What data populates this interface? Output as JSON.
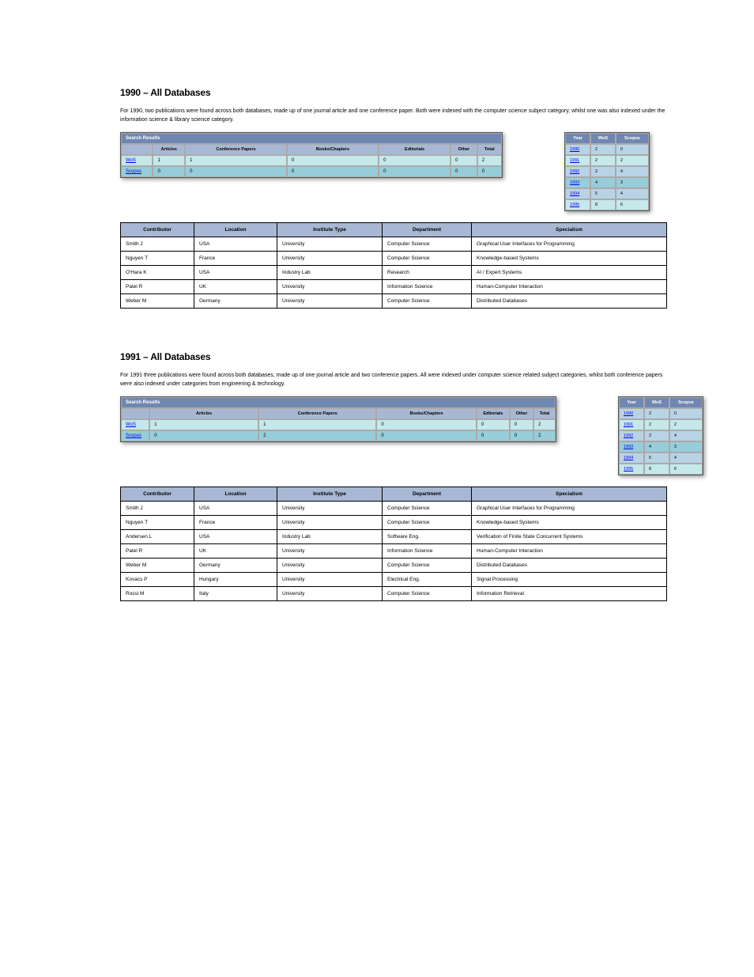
{
  "section1": {
    "title": "1990 – All Databases",
    "blurb": "For 1990, two publications were found across both databases, made up of one journal article and one conference paper. Both were indexed with the computer science subject category, whilst one was also indexed under the information science & library science category.",
    "results": {
      "band": "Search Results",
      "columns": [
        "db",
        "Articles",
        "Conference Papers",
        "Books/Chapters",
        "Editorials",
        "Other",
        "Total"
      ],
      "rows": [
        {
          "db": "WoS",
          "articles": "1",
          "conf": "1",
          "books": "0",
          "editorials": "0",
          "other": "0",
          "total": "2"
        },
        {
          "db": "Scopus",
          "articles": "0",
          "conf": "0",
          "books": "0",
          "editorials": "0",
          "other": "0",
          "total": "0"
        }
      ]
    },
    "side": {
      "headers": [
        "Year",
        "WoS",
        "Scopus"
      ],
      "rows": [
        {
          "y": "1990",
          "a": "2",
          "b": "0",
          "cls": "alt"
        },
        {
          "y": "1991",
          "a": "2",
          "b": "2",
          "cls": "light"
        },
        {
          "y": "1992",
          "a": "2",
          "b": "4",
          "cls": "alt"
        },
        {
          "y": "1993",
          "a": "4",
          "b": "3",
          "cls": "mid"
        },
        {
          "y": "1994",
          "a": "5",
          "b": "4",
          "cls": "alt"
        },
        {
          "y": "1995",
          "a": "8",
          "b": "6",
          "cls": "light"
        }
      ]
    },
    "contrib": {
      "headers": [
        "Contributor",
        "Location",
        "Institute Type",
        "Department",
        "Specialism"
      ],
      "rows": [
        {
          "c": "Smith J",
          "l": "USA",
          "t": "University",
          "d": "Computer Science",
          "s": "Graphical User Interfaces for Programming"
        },
        {
          "c": "Nguyen T",
          "l": "France",
          "t": "University",
          "d": "Computer Science",
          "s": "Knowledge-based Systems"
        },
        {
          "c": "O'Hara K",
          "l": "USA",
          "t": "Industry Lab",
          "d": "Research",
          "s": "AI / Expert Systems"
        },
        {
          "c": "Patel R",
          "l": "UK",
          "t": "University",
          "d": "Information Science",
          "s": "Human-Computer Interaction"
        },
        {
          "c": "Weber M",
          "l": "Germany",
          "t": "University",
          "d": "Computer Science",
          "s": "Distributed Databases"
        }
      ]
    }
  },
  "section2": {
    "title": "1991 – All Databases",
    "blurb": "For 1991 three publications were found across both databases, made up of one journal article and two conference papers. All were indexed under computer science related subject categories, whilst both conference papers were also indexed under categories from engineering & technology.",
    "results": {
      "band": "Search Results",
      "columns": [
        "db",
        "Articles",
        "Conference Papers",
        "Books/Chapters",
        "Editorials",
        "Other",
        "Total"
      ],
      "rows": [
        {
          "db": "WoS",
          "articles": "1",
          "conf": "1",
          "books": "0",
          "editorials": "0",
          "other": "0",
          "total": "2"
        },
        {
          "db": "Scopus",
          "articles": "0",
          "conf": "2",
          "books": "0",
          "editorials": "0",
          "other": "0",
          "total": "2"
        }
      ]
    },
    "side": {
      "headers": [
        "Year",
        "WoS",
        "Scopus"
      ],
      "rows": [
        {
          "y": "1990",
          "a": "2",
          "b": "0",
          "cls": "alt"
        },
        {
          "y": "1991",
          "a": "2",
          "b": "2",
          "cls": "light"
        },
        {
          "y": "1992",
          "a": "2",
          "b": "4",
          "cls": "alt"
        },
        {
          "y": "1993",
          "a": "4",
          "b": "3",
          "cls": "mid"
        },
        {
          "y": "1994",
          "a": "5",
          "b": "4",
          "cls": "alt"
        },
        {
          "y": "1995",
          "a": "8",
          "b": "6",
          "cls": "light"
        }
      ]
    },
    "contrib": {
      "headers": [
        "Contributor",
        "Location",
        "Institute Type",
        "Department",
        "Specialism"
      ],
      "rows": [
        {
          "c": "Smith J",
          "l": "USA",
          "t": "University",
          "d": "Computer Science",
          "s": "Graphical User Interfaces for Programming"
        },
        {
          "c": "Nguyen T",
          "l": "France",
          "t": "University",
          "d": "Computer Science",
          "s": "Knowledge-based Systems"
        },
        {
          "c": "Andersen L",
          "l": "USA",
          "t": "Industry Lab",
          "d": "Software Eng.",
          "s": "Verification of Finite State Concurrent Systems"
        },
        {
          "c": "Patel R",
          "l": "UK",
          "t": "University",
          "d": "Information Science",
          "s": "Human-Computer Interaction"
        },
        {
          "c": "Weber M",
          "l": "Germany",
          "t": "University",
          "d": "Computer Science",
          "s": "Distributed Databases"
        },
        {
          "c": "Kovacs P",
          "l": "Hungary",
          "t": "University",
          "d": "Electrical Eng.",
          "s": "Signal Processing"
        },
        {
          "c": "Rossi M",
          "l": "Italy",
          "t": "University",
          "d": "Computer Science",
          "s": "Information Retrieval"
        }
      ]
    }
  }
}
